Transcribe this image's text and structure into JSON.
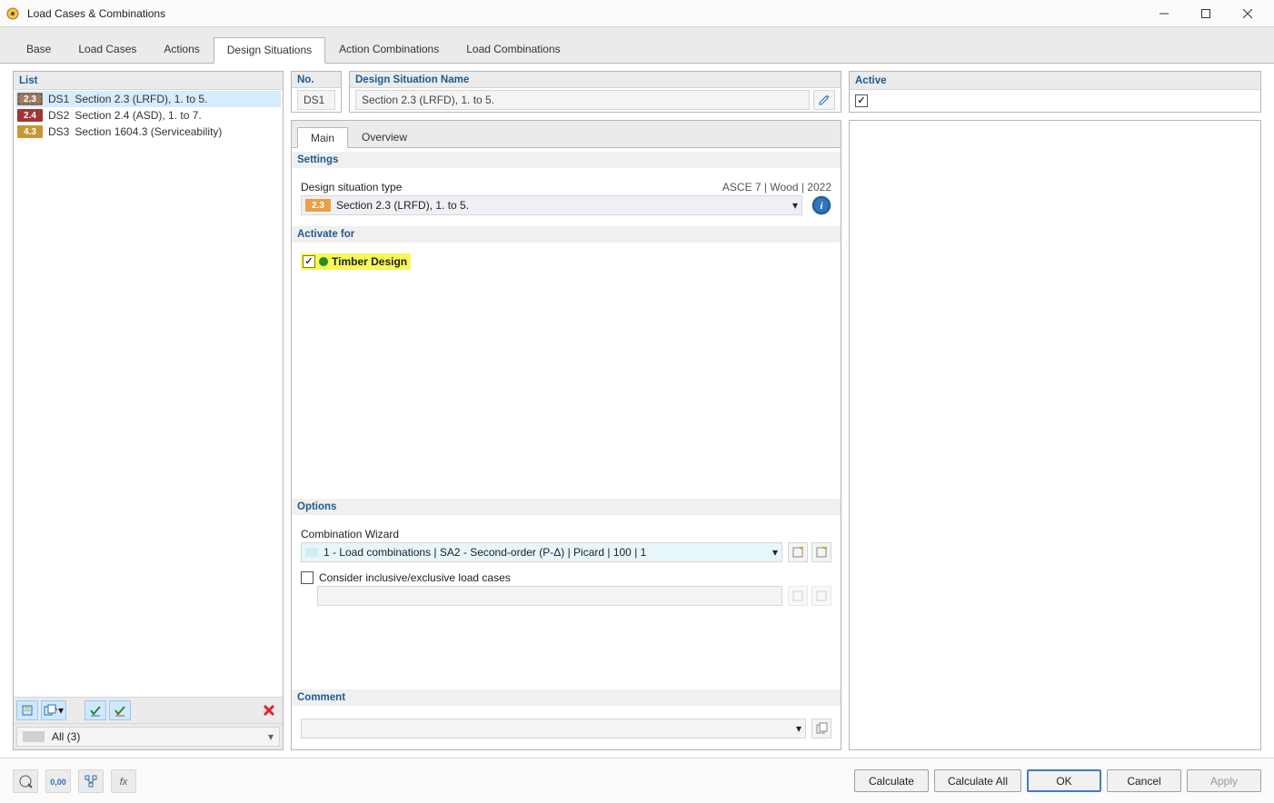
{
  "window": {
    "title": "Load Cases & Combinations"
  },
  "tabs": {
    "items": [
      {
        "label": "Base"
      },
      {
        "label": "Load Cases"
      },
      {
        "label": "Actions"
      },
      {
        "label": "Design Situations"
      },
      {
        "label": "Action Combinations"
      },
      {
        "label": "Load Combinations"
      }
    ],
    "active_index": 3
  },
  "left": {
    "header": "List",
    "items": [
      {
        "badge": "2.3",
        "badge_color": "#a07a5e",
        "code": "DS1",
        "desc": "Section 2.3 (LRFD), 1. to 5.",
        "selected": true
      },
      {
        "badge": "2.4",
        "badge_color": "#a03535",
        "code": "DS2",
        "desc": "Section 2.4 (ASD), 1. to 7.",
        "selected": false
      },
      {
        "badge": "4.3",
        "badge_color": "#c49836",
        "code": "DS3",
        "desc": "Section 1604.3 (Serviceability)",
        "selected": false
      }
    ],
    "filter": "All (3)"
  },
  "top_panes": {
    "no_header": "No.",
    "no_value": "DS1",
    "name_header": "Design Situation Name",
    "name_value": "Section 2.3 (LRFD), 1. to 5.",
    "active_header": "Active",
    "active_checked": true
  },
  "sub_tabs": {
    "items": [
      {
        "label": "Main"
      },
      {
        "label": "Overview"
      }
    ],
    "active_index": 0
  },
  "settings": {
    "header": "Settings",
    "type_label": "Design situation type",
    "standard_label": "ASCE 7 | Wood | 2022",
    "type_badge": "2.3",
    "type_badge_color": "#e8a046",
    "type_value": "Section 2.3 (LRFD), 1. to 5."
  },
  "activate": {
    "header": "Activate for",
    "timber_label": "Timber Design",
    "timber_checked": true
  },
  "options": {
    "header": "Options",
    "wizard_label": "Combination Wizard",
    "wizard_value": "1 - Load combinations | SA2 - Second-order (P-Δ) | Picard | 100 | 1",
    "consider_checked": false,
    "consider_label": "Consider inclusive/exclusive load cases"
  },
  "comment": {
    "header": "Comment",
    "value": ""
  },
  "footer": {
    "calculate": "Calculate",
    "calculate_all": "Calculate All",
    "ok": "OK",
    "cancel": "Cancel",
    "apply": "Apply"
  }
}
